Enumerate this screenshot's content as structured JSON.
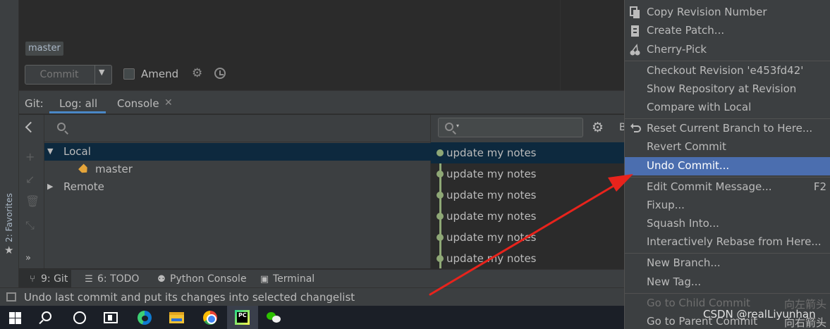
{
  "favorites": {
    "label": "2: Favorites"
  },
  "commit_panel": {
    "branch": "master",
    "commit_label": "Commit",
    "amend_label": "Amend"
  },
  "git_tabs": {
    "prefix": "Git:",
    "tabs": [
      {
        "label": "Log: all",
        "active": true
      },
      {
        "label": "Console",
        "active": false
      }
    ]
  },
  "branch_tree": {
    "local_label": "Local",
    "local_branch": "master",
    "remote_label": "Remote"
  },
  "log": {
    "toolbar_truncated": "B",
    "commits": [
      {
        "message": "update my notes"
      },
      {
        "message": "update my notes"
      },
      {
        "message": "update my notes"
      },
      {
        "message": "update my notes"
      },
      {
        "message": "update my notes"
      },
      {
        "message": "update my notes"
      }
    ]
  },
  "tool_windows": [
    {
      "label": "9: Git",
      "icon": "git-branch-icon"
    },
    {
      "label": "6: TODO",
      "icon": "todo-list-icon"
    },
    {
      "label": "Python Console",
      "icon": "python-icon"
    },
    {
      "label": "Terminal",
      "icon": "terminal-icon"
    }
  ],
  "status_bar": {
    "text": "Undo last commit and put its changes into selected changelist"
  },
  "context_menu": {
    "items": [
      {
        "label": "Copy Revision Number",
        "icon": "copy-icon"
      },
      {
        "label": "Create Patch...",
        "icon": "patch-icon"
      },
      {
        "label": "Cherry-Pick",
        "icon": "cherry-icon"
      },
      {
        "label": "Checkout Revision 'e453fd42'"
      },
      {
        "label": "Show Repository at Revision"
      },
      {
        "label": "Compare with Local"
      },
      {
        "label": "Reset Current Branch to Here...",
        "icon": "reset-icon"
      },
      {
        "label": "Revert Commit"
      },
      {
        "label": "Undo Commit...",
        "selected": true
      },
      {
        "label": "Edit Commit Message...",
        "shortcut": "F2"
      },
      {
        "label": "Fixup..."
      },
      {
        "label": "Squash Into..."
      },
      {
        "label": "Interactively Rebase from Here..."
      },
      {
        "label": "New Branch..."
      },
      {
        "label": "New Tag..."
      },
      {
        "label": "Go to Child Commit",
        "shortcut": "向左箭头",
        "disabled": true
      },
      {
        "label": "Go to Parent Commit",
        "shortcut": "向右箭头"
      }
    ]
  },
  "watermark": "CSDN @realLiyunhan",
  "colors": {
    "selection": "#4b6eaf",
    "graph": "#8fa876",
    "arrow": "#e8231c",
    "tab_underline": "#4a88c7"
  }
}
